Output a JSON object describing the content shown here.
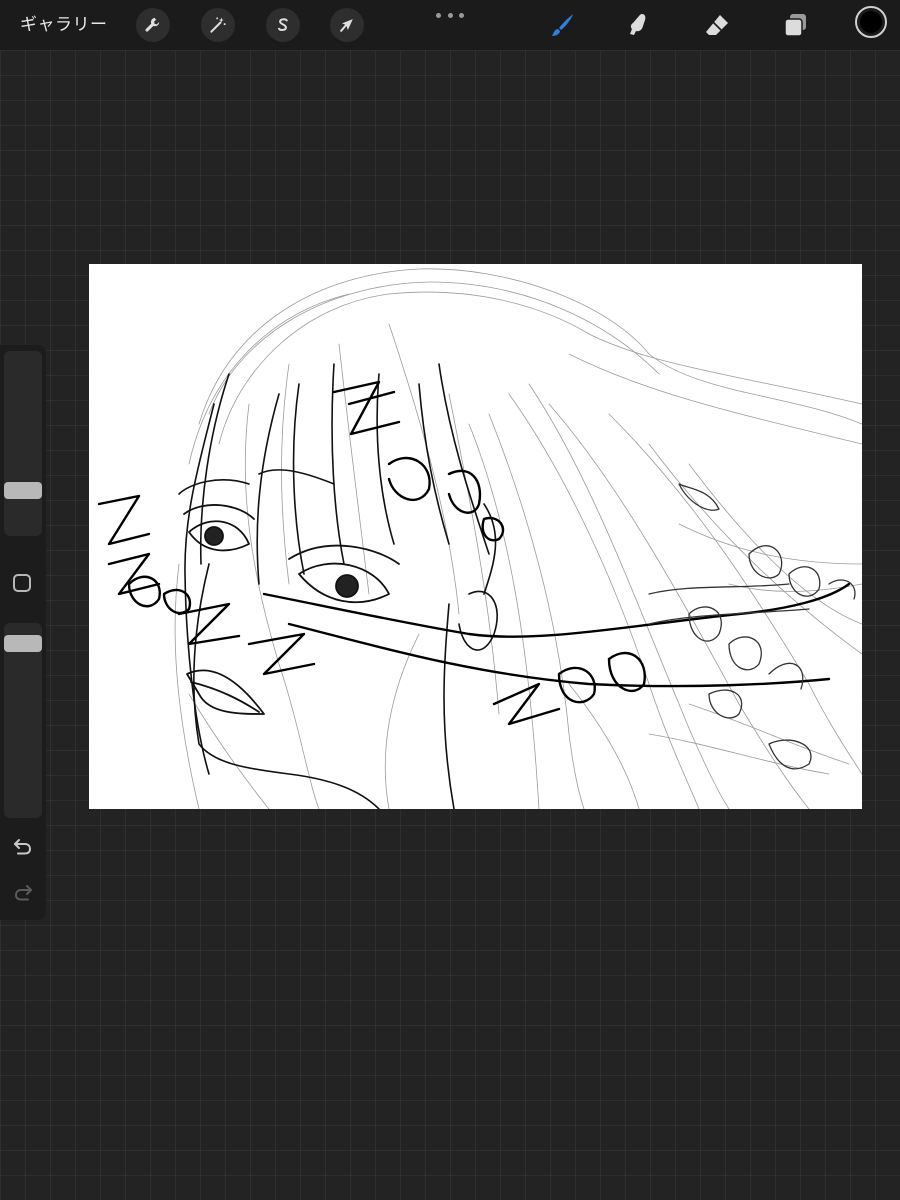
{
  "topbar": {
    "gallery_label": "ギャラリー",
    "left_tools": [
      {
        "name": "actions",
        "icon": "wrench-icon"
      },
      {
        "name": "adjustments",
        "icon": "magic-wand-icon"
      },
      {
        "name": "selection",
        "icon": "selection-s-icon"
      },
      {
        "name": "transform",
        "icon": "arrow-cursor-icon"
      }
    ],
    "more_icon": "more-dots-icon",
    "right_tools": [
      {
        "name": "brush",
        "icon": "brush-icon",
        "active": true
      },
      {
        "name": "smudge",
        "icon": "smudge-finger-icon",
        "active": false
      },
      {
        "name": "eraser",
        "icon": "eraser-icon",
        "active": false
      },
      {
        "name": "layers",
        "icon": "layers-icon",
        "active": false
      }
    ],
    "current_color": "#000000"
  },
  "sidebar": {
    "brush_size_level": 0.22,
    "brush_opacity_level": 0.93,
    "modify_icon": "square-modify-icon",
    "undo_icon": "undo-arrow-icon",
    "redo_icon": "redo-arrow-icon"
  },
  "colors": {
    "accent": "#2f7fe0",
    "toolbar_bg": "#1b1b1b",
    "workspace_bg": "#232323",
    "canvas_bg": "#ffffff"
  }
}
